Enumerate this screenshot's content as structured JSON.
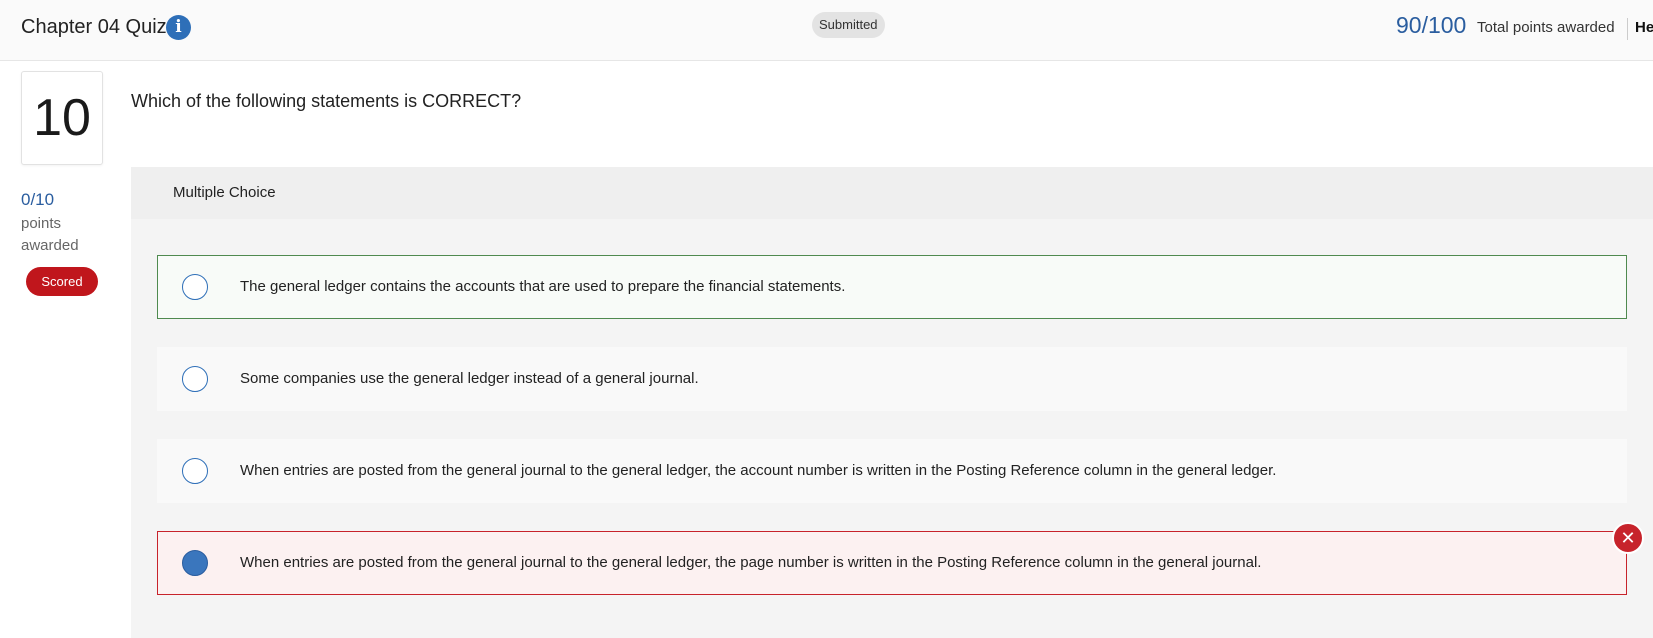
{
  "header": {
    "title": "Chapter 04 Quiz",
    "info_icon": "info-icon",
    "status": "Submitted",
    "points_total": "90/100",
    "points_total_label": "Total points awarded",
    "help_label": "Help"
  },
  "question": {
    "number": "10",
    "points": "0/10",
    "points_label": "points awarded",
    "scored_badge": "Scored",
    "text": "Which of the following statements is CORRECT?",
    "type_label": "Multiple Choice",
    "choices": [
      {
        "text": "The general ledger contains the accounts that are used to prepare the financial statements.",
        "state": "correct",
        "selected": false
      },
      {
        "text": "Some companies use the general ledger instead of a general journal.",
        "state": "neutral",
        "selected": false
      },
      {
        "text": "When entries are posted from the general journal to the general ledger, the account number is written in the Posting Reference column in the general ledger.",
        "state": "neutral",
        "selected": false
      },
      {
        "text": "When entries are posted from the general journal to the general ledger, the page number is written in the Posting Reference column in the general journal.",
        "state": "incorrect",
        "selected": true
      }
    ],
    "incorrect_icon": "x-circle-icon"
  },
  "colors": {
    "accent": "#2e6fb8",
    "correct_border": "#4f8a4f",
    "incorrect_border": "#c7232b",
    "scored_badge": "#c0161c"
  }
}
